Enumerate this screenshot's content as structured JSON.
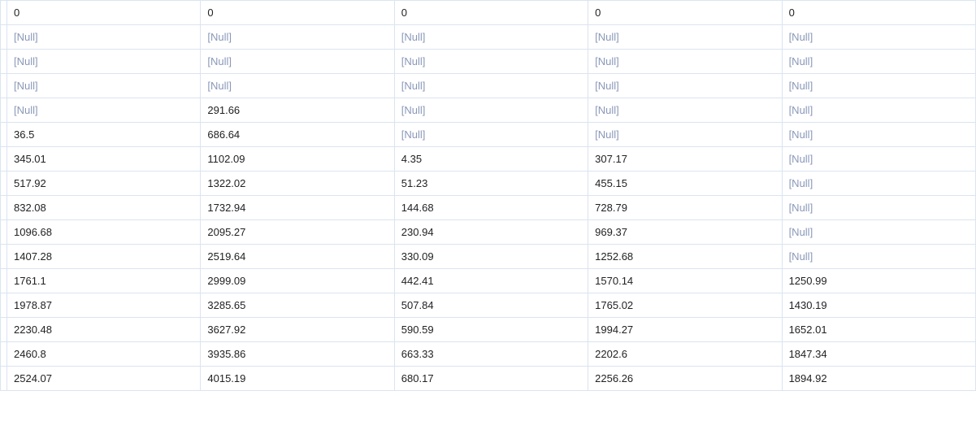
{
  "table": {
    "nullLabel": "[Null]",
    "headers": [
      "0",
      "0",
      "0",
      "0",
      "0"
    ],
    "rows": [
      [
        null,
        null,
        null,
        null,
        null
      ],
      [
        null,
        null,
        null,
        null,
        null
      ],
      [
        null,
        null,
        null,
        null,
        null
      ],
      [
        null,
        "291.66",
        null,
        null,
        null
      ],
      [
        "36.5",
        "686.64",
        null,
        null,
        null
      ],
      [
        "345.01",
        "1102.09",
        "4.35",
        "307.17",
        null
      ],
      [
        "517.92",
        "1322.02",
        "51.23",
        "455.15",
        null
      ],
      [
        "832.08",
        "1732.94",
        "144.68",
        "728.79",
        null
      ],
      [
        "1096.68",
        "2095.27",
        "230.94",
        "969.37",
        null
      ],
      [
        "1407.28",
        "2519.64",
        "330.09",
        "1252.68",
        null
      ],
      [
        "1761.1",
        "2999.09",
        "442.41",
        "1570.14",
        "1250.99"
      ],
      [
        "1978.87",
        "3285.65",
        "507.84",
        "1765.02",
        "1430.19"
      ],
      [
        "2230.48",
        "3627.92",
        "590.59",
        "1994.27",
        "1652.01"
      ],
      [
        "2460.8",
        "3935.86",
        "663.33",
        "2202.6",
        "1847.34"
      ],
      [
        "2524.07",
        "4015.19",
        "680.17",
        "2256.26",
        "1894.92"
      ]
    ]
  }
}
